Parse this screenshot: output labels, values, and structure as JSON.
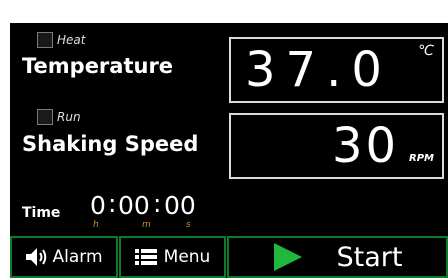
{
  "heat": {
    "label": "Heat",
    "checked": false
  },
  "temperature": {
    "label": "Temperature",
    "value": "37.0",
    "unit": "℃"
  },
  "run": {
    "label": "Run",
    "checked": false
  },
  "shaking": {
    "label": "Shaking Speed",
    "value": "30",
    "unit": "RPM"
  },
  "time": {
    "label": "Time",
    "hours": "0",
    "minutes": "00",
    "seconds": "00",
    "sep": ":",
    "hours_unit": "h",
    "minutes_unit": "m",
    "seconds_unit": "s"
  },
  "buttons": {
    "alarm": {
      "label": "Alarm",
      "icon": "speaker-icon"
    },
    "menu": {
      "label": "Menu",
      "icon": "list-icon"
    },
    "start": {
      "label": "Start",
      "icon": "play-icon"
    }
  },
  "colors": {
    "background": "#000000",
    "border": "#0f7a2a",
    "accent": "#1fb83d",
    "time_units": "#d78f1e"
  }
}
